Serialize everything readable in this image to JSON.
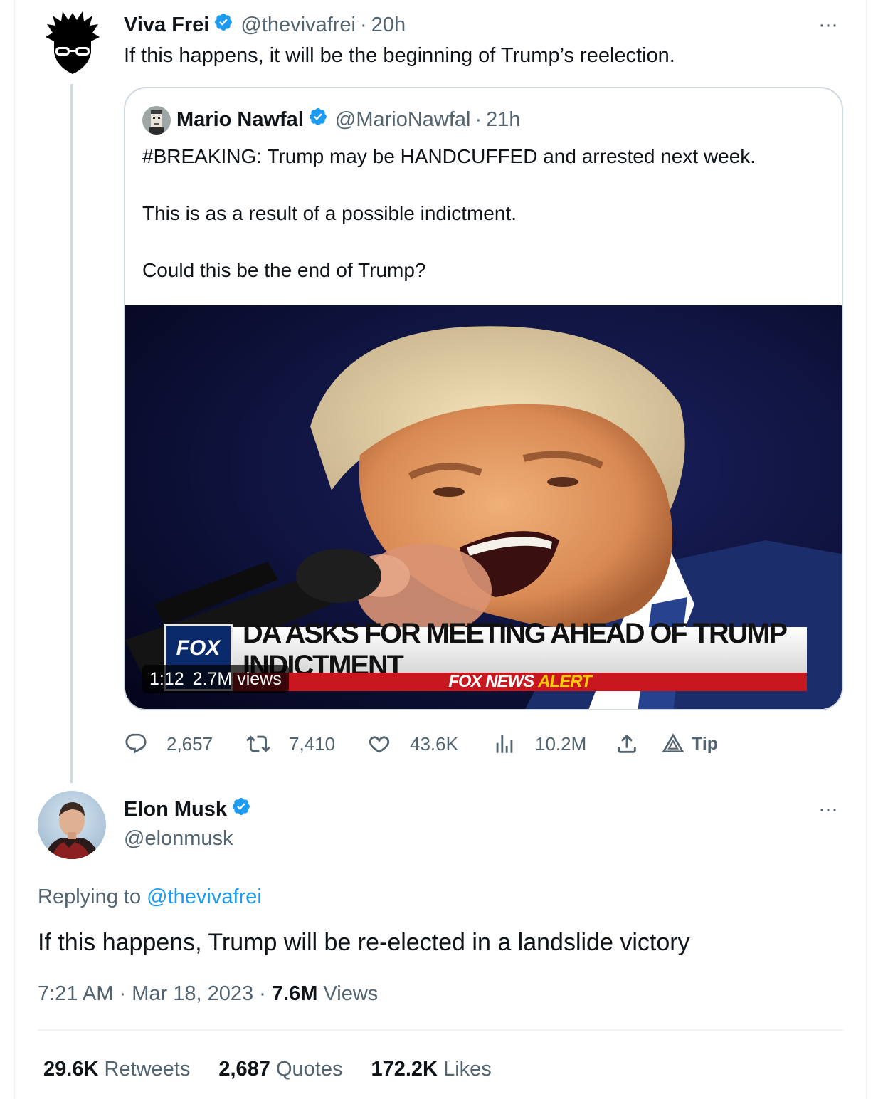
{
  "viva_tweet": {
    "name": "Viva Frei",
    "handle": "@thevivafrei",
    "separator": "·",
    "time": "20h",
    "more": "···",
    "text": "If this happens, it will be the beginning of Trump’s reelection."
  },
  "quoted_tweet": {
    "name": "Mario Nawfal",
    "handle": "@MarioNawfal",
    "separator": "·",
    "time": "21h",
    "lines": [
      "#BREAKING: Trump may be HANDCUFFED and arrested next week.",
      "This is as a result of a possible indictment.",
      "Could this be the end of Trump?"
    ],
    "video": {
      "duration": "1:12",
      "views": "2.7M views",
      "chyron_headline": "DA ASKS FOR MEETING AHEAD OF TRUMP INDICTMENT",
      "chyron_sub": "FOX NEWS",
      "chyron_alert": "ALERT",
      "logo_text": "FOX"
    }
  },
  "viva_actions": {
    "replies": "2,657",
    "retweets": "7,410",
    "likes": "43.6K",
    "views": "10.2M",
    "tip_label": "Tip"
  },
  "elon_tweet": {
    "name": "Elon Musk",
    "handle": "@elonmusk",
    "more": "···",
    "replying_prefix": "Replying to",
    "replying_handle": "@thevivafrei",
    "text": "If this happens, Trump will be re-elected in a landslide victory",
    "time": "7:21 AM",
    "separator": "·",
    "date": "Mar 18, 2023",
    "views_count": "7.6M",
    "views_label": "Views"
  },
  "elon_stats": {
    "retweets_count": "29.6K",
    "retweets_label": "Retweets",
    "quotes_count": "2,687",
    "quotes_label": "Quotes",
    "likes_count": "172.2K",
    "likes_label": "Likes"
  },
  "colors": {
    "verified": "#1d9bf0",
    "link": "#1d9bf0",
    "secondary_text": "#536471",
    "thread_line": "#cfd9de"
  },
  "icons": [
    "verified-badge-icon",
    "more-icon",
    "reply-icon",
    "retweet-icon",
    "like-icon",
    "views-icon",
    "share-icon",
    "tip-icon"
  ]
}
